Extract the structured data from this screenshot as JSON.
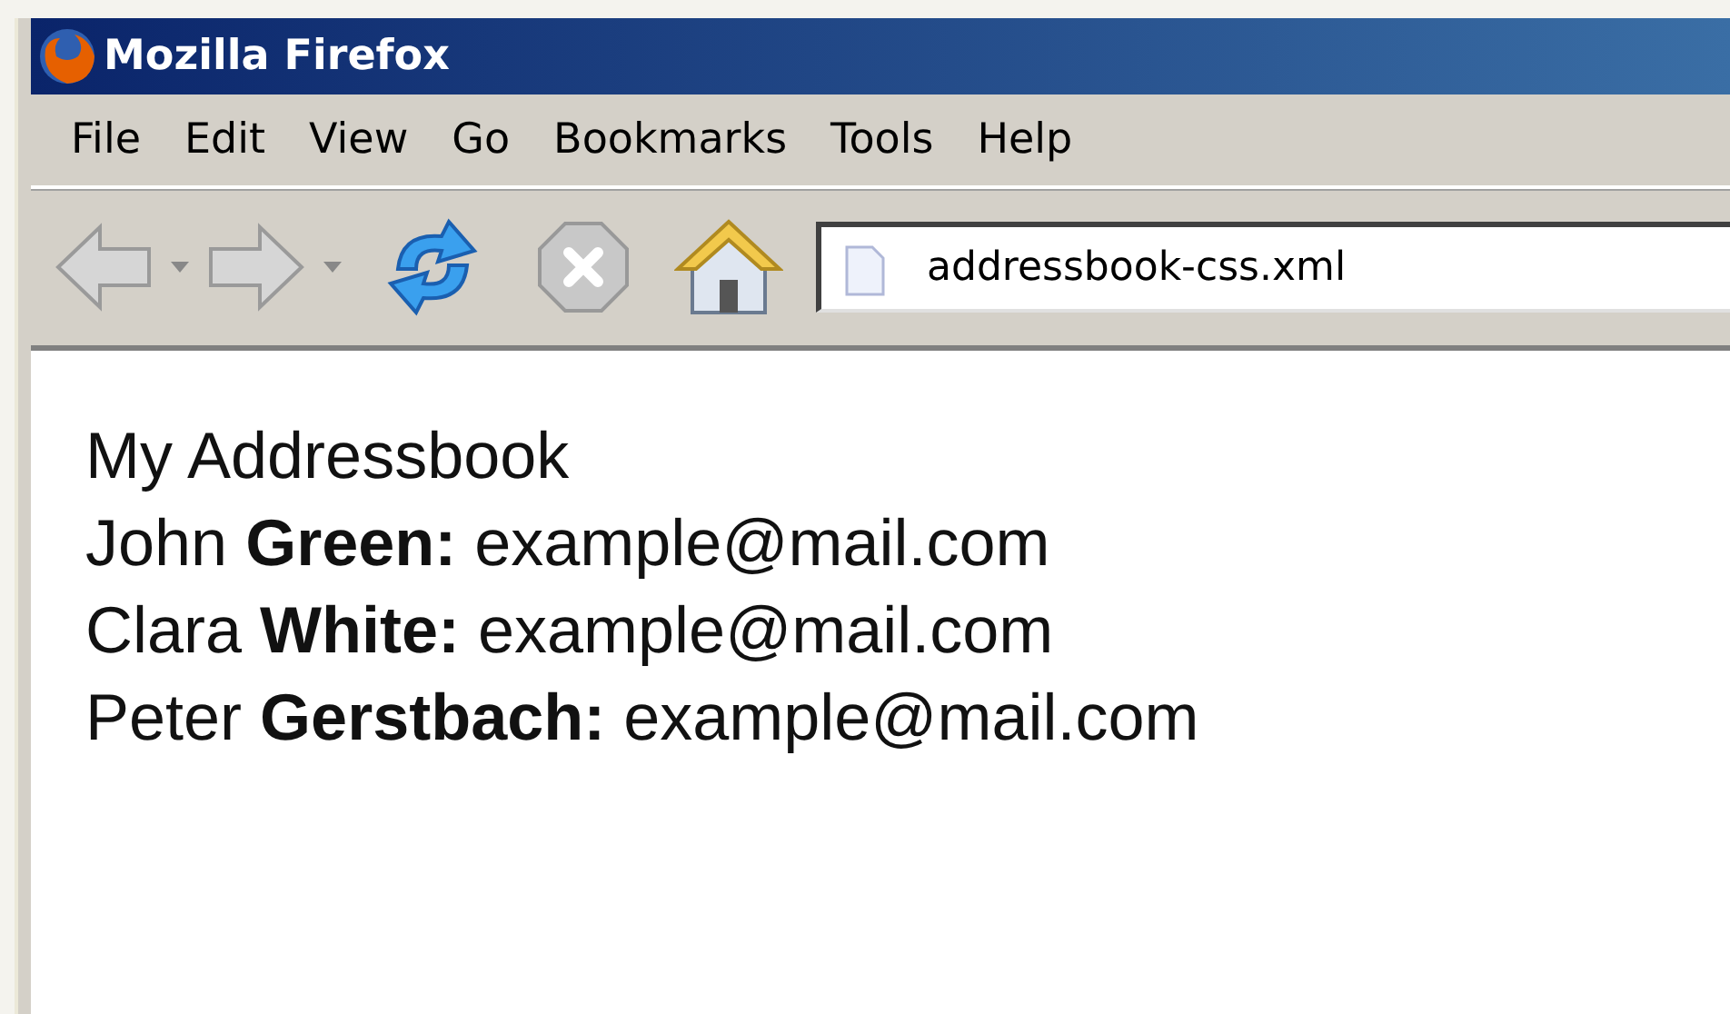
{
  "window": {
    "title": "Mozilla Firefox"
  },
  "menu": [
    "File",
    "Edit",
    "View",
    "Go",
    "Bookmarks",
    "Tools",
    "Help"
  ],
  "address_bar": {
    "value": "addressbook-css.xml"
  },
  "page": {
    "heading": "My Addressbook",
    "entries": [
      "John **Green:** example@mail.com",
      "Clara **White:** example@mail.com",
      "Peter **Gerstbach:** example@mail.com"
    ]
  }
}
